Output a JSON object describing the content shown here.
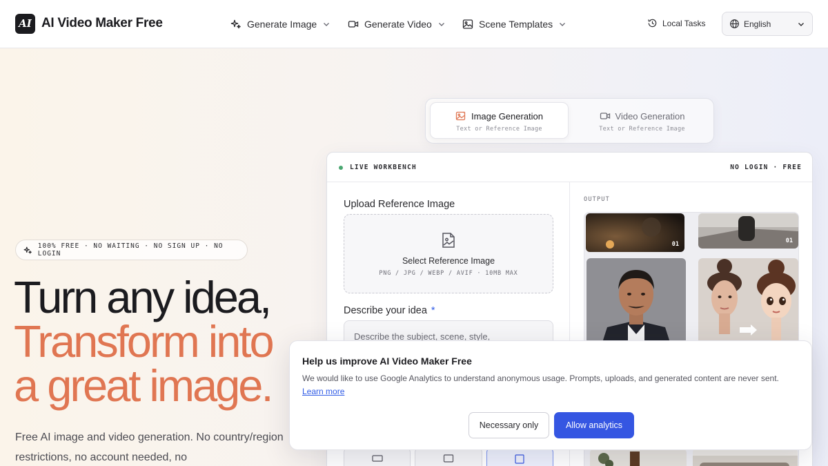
{
  "header": {
    "logo_text": "AI",
    "brand": "AI Video Maker Free",
    "nav": [
      {
        "label": "Generate Image",
        "icon": "sparkle-icon"
      },
      {
        "label": "Generate Video",
        "icon": "video-camera-icon"
      },
      {
        "label": "Scene Templates",
        "icon": "image-icon"
      }
    ],
    "local_tasks": "Local Tasks",
    "language": "English"
  },
  "hero": {
    "badge": "100% FREE · NO WAITING · NO SIGN UP · NO LOGIN",
    "line1": "Turn any idea,",
    "line2": "Transform into",
    "line3": "a great image.",
    "description": "Free AI image and video generation. No country/region restrictions, no account needed, no"
  },
  "mode_tabs": [
    {
      "title": "Image Generation",
      "subtitle": "Text or Reference Image",
      "active": true
    },
    {
      "title": "Video Generation",
      "subtitle": "Text or Reference Image",
      "active": false
    }
  ],
  "workbench": {
    "title": "LIVE WORKBENCH",
    "right_label": "NO LOGIN · FREE",
    "upload_label": "Upload Reference Image",
    "upload_title": "Select Reference Image",
    "upload_formats": "PNG / JPG / WEBP / AVIF · 10MB MAX",
    "describe_label": "Describe your idea",
    "required_mark": "*",
    "prompt_placeholder": "Describe the subject, scene, style,",
    "output_label": "OUTPUT",
    "thumb_badges": [
      "01",
      "01"
    ]
  },
  "consent": {
    "title": "Help us improve AI Video Maker Free",
    "text": "We would like to use Google Analytics to understand anonymous usage. Prompts, uploads, and generated content are never sent.",
    "learn_more": "Learn more",
    "btn_necessary": "Necessary only",
    "btn_allow": "Allow analytics"
  },
  "colors": {
    "accent": "#e07652",
    "primary_button": "#3556e2",
    "live_dot": "#4aa771"
  }
}
